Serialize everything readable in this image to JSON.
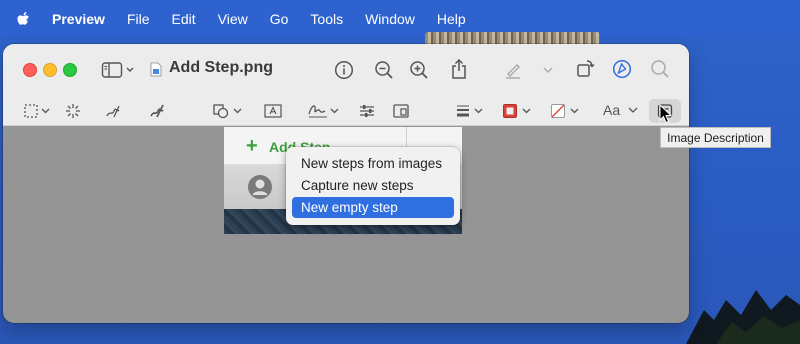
{
  "menubar": {
    "items": [
      "Preview",
      "File",
      "Edit",
      "View",
      "Go",
      "Tools",
      "Window",
      "Help"
    ]
  },
  "window": {
    "title": "Add Step.png",
    "toolbar": {
      "text_style_label": "Aa"
    }
  },
  "image": {
    "add_step_label": "Add Step"
  },
  "popup_menu": {
    "items": [
      "New steps from images",
      "Capture new steps",
      "New empty step"
    ],
    "selected_index": 2
  },
  "tooltip": {
    "text": "Image Description"
  },
  "colors": {
    "menubar": "#2d62cf",
    "desktop": "#2a5cc4",
    "window_chrome": "#ececec",
    "canvas": "#959595",
    "selection": "#2f6fe0",
    "accent_green": "#3ea03e",
    "markup_active": "#2c6be0",
    "border_color_swatch": "#d9413a"
  },
  "icons": [
    "apple-icon",
    "sidebar-icon",
    "info-icon",
    "zoom-out-icon",
    "zoom-in-icon",
    "share-icon",
    "highlight-icon",
    "rotate-icon",
    "markup-icon",
    "search-icon",
    "selection-icon",
    "instant-alpha-icon",
    "sketch-icon",
    "draw-icon",
    "shapes-icon",
    "text-icon",
    "sign-icon",
    "adjust-color-icon",
    "adjust-size-icon",
    "shape-style-icon",
    "border-color-icon",
    "fill-color-icon",
    "image-description-icon"
  ]
}
